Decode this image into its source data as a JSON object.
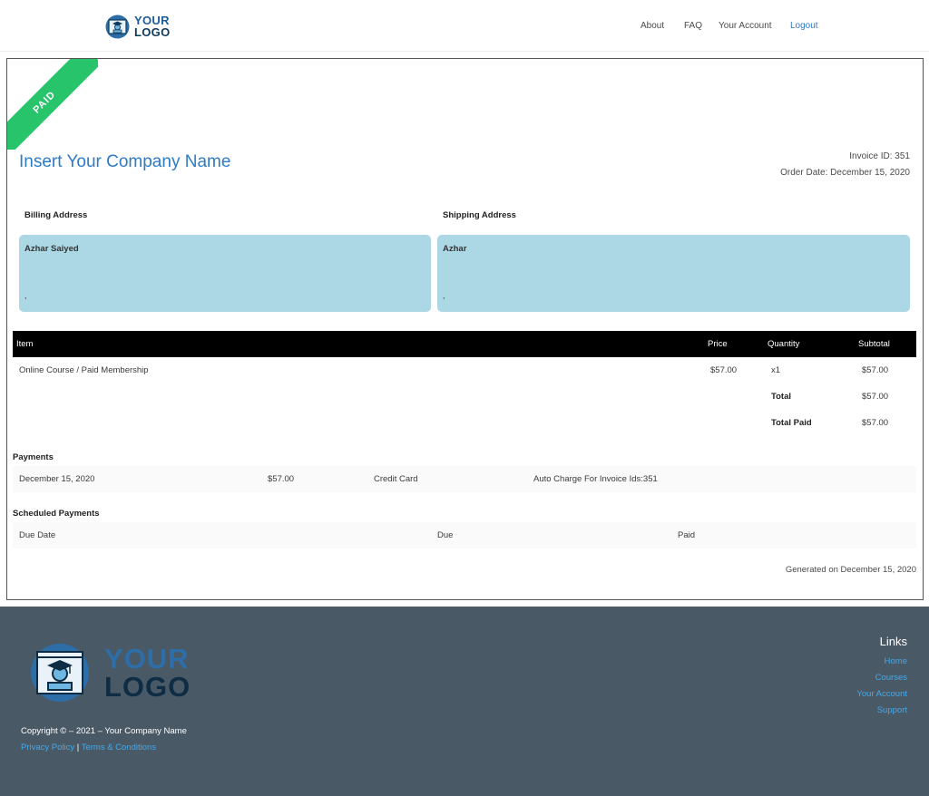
{
  "header": {
    "logo": {
      "line1": "YOUR",
      "line2": "LOGO"
    },
    "nav": [
      {
        "label": "About"
      },
      {
        "label": "FAQ"
      },
      {
        "label": "Your Account"
      },
      {
        "label": "Logout"
      }
    ]
  },
  "invoice": {
    "ribbon": "PAID",
    "company_name": "Insert Your Company Name",
    "invoice_id": "Invoice ID: 351",
    "order_date": "Order Date: December 15, 2020",
    "billing": {
      "label": "Billing Address",
      "name": "Azhar Saiyed",
      "line": ","
    },
    "shipping": {
      "label": "Shipping Address",
      "name": "Azhar",
      "line": ","
    },
    "table": {
      "headers": {
        "item": "Item",
        "price": "Price",
        "quantity": "Quantity",
        "subtotal": "Subtotal"
      },
      "rows": [
        {
          "item": "Online Course / Paid Membership",
          "price": "$57.00",
          "quantity": "x1",
          "subtotal": "$57.00"
        }
      ],
      "total_label": "Total",
      "total_value": "$57.00",
      "total_paid_label": "Total Paid",
      "total_paid_value": "$57.00"
    },
    "payments": {
      "title": "Payments",
      "rows": [
        {
          "date": "December 15, 2020",
          "amount": "$57.00",
          "method": "Credit Card",
          "note": "Auto Charge For Invoice Ids:351"
        }
      ]
    },
    "scheduled": {
      "title": "Scheduled Payments",
      "headers": {
        "due_date": "Due Date",
        "due": "Due",
        "paid": "Paid"
      }
    },
    "generated": "Generated on December 15, 2020"
  },
  "footer": {
    "logo": {
      "line1": "YOUR",
      "line2": "LOGO"
    },
    "copyright": "Copyright © – 2021 – Your Company Name",
    "privacy": "Privacy Policy",
    "separator": "|",
    "terms": "Terms & Conditions",
    "links_title": "Links",
    "links": [
      {
        "label": "Home"
      },
      {
        "label": "Courses"
      },
      {
        "label": "Your Account"
      },
      {
        "label": "Support"
      }
    ]
  },
  "colors": {
    "accent": "#2d7bc4",
    "paid_ribbon": "#27c46b",
    "address_box": "#acd8e6",
    "footer_bg": "#4a5966",
    "footer_link": "#44a9ea"
  }
}
